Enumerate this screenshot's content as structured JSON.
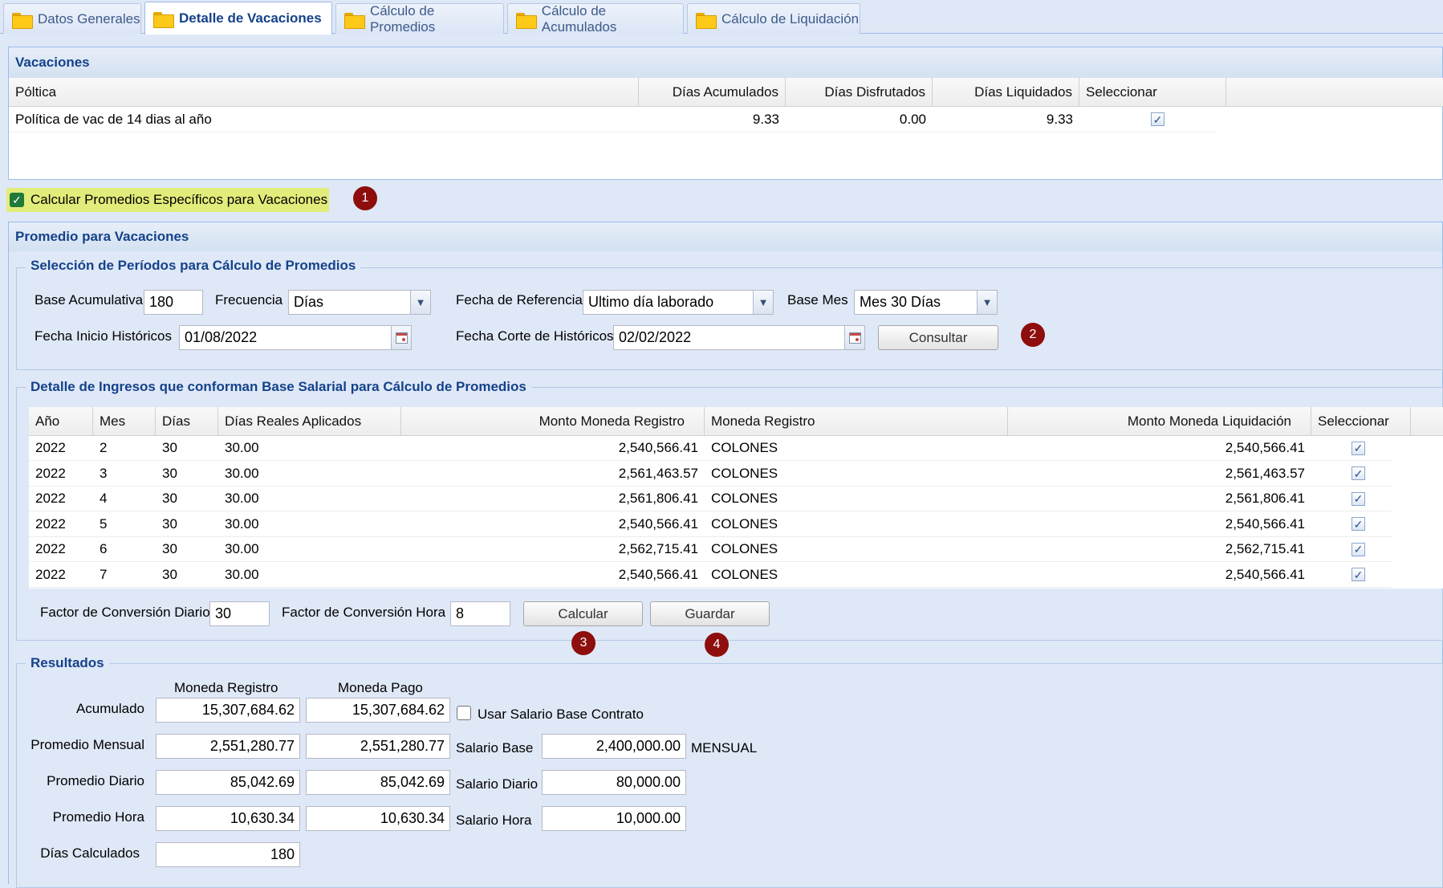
{
  "tabs": [
    {
      "label": "Datos Generales"
    },
    {
      "label": "Detalle de Vacaciones"
    },
    {
      "label": "Cálculo de Promedios"
    },
    {
      "label": "Cálculo de Acumulados"
    },
    {
      "label": "Cálculo de Liquidación"
    }
  ],
  "vacaciones": {
    "title": "Vacaciones",
    "headers": [
      "Póltica",
      "Días Acumulados",
      "Días Disfrutados",
      "Días Liquidados",
      "Seleccionar"
    ],
    "row": {
      "politica": "Política de vac de 14 dias al año",
      "acumulados": "9.33",
      "disfrutados": "0.00",
      "liquidados": "9.33",
      "selected": true
    }
  },
  "calc_checkbox": {
    "label": "Calcular Promedios Específicos para Vacaciones",
    "checked": true
  },
  "markers": [
    "1",
    "2",
    "3",
    "4"
  ],
  "promedio": {
    "title": "Promedio para Vacaciones",
    "seleccion": {
      "legend": "Selección de Períodos para Cálculo de Promedios",
      "base_acumulativa_label": "Base Acumulativa",
      "base_acumulativa": "180",
      "frecuencia_label": "Frecuencia",
      "frecuencia": "Días",
      "fecha_ref_label": "Fecha de Referencia",
      "fecha_ref": "Ultimo día laborado",
      "base_mes_label": "Base Mes",
      "base_mes": "Mes 30 Días",
      "fecha_inicio_label": "Fecha Inicio Históricos",
      "fecha_inicio": "01/08/2022",
      "fecha_corte_label": "Fecha Corte de Históricos",
      "fecha_corte": "02/02/2022",
      "consultar": "Consultar"
    },
    "detalle": {
      "legend": "Detalle de Ingresos que conforman Base Salarial para Cálculo de Promedios",
      "headers": [
        "Año",
        "Mes",
        "Días",
        "Días Reales Aplicados",
        "Monto Moneda Registro",
        "Moneda Registro",
        "Monto Moneda Liquidación",
        "Seleccionar"
      ],
      "rows": [
        {
          "anio": "2022",
          "mes": "2",
          "dias": "30",
          "reales": "30.00",
          "monto": "2,540,566.41",
          "moneda": "COLONES",
          "liq": "2,540,566.41",
          "sel": true
        },
        {
          "anio": "2022",
          "mes": "3",
          "dias": "30",
          "reales": "30.00",
          "monto": "2,561,463.57",
          "moneda": "COLONES",
          "liq": "2,561,463.57",
          "sel": true
        },
        {
          "anio": "2022",
          "mes": "4",
          "dias": "30",
          "reales": "30.00",
          "monto": "2,561,806.41",
          "moneda": "COLONES",
          "liq": "2,561,806.41",
          "sel": true
        },
        {
          "anio": "2022",
          "mes": "5",
          "dias": "30",
          "reales": "30.00",
          "monto": "2,540,566.41",
          "moneda": "COLONES",
          "liq": "2,540,566.41",
          "sel": true
        },
        {
          "anio": "2022",
          "mes": "6",
          "dias": "30",
          "reales": "30.00",
          "monto": "2,562,715.41",
          "moneda": "COLONES",
          "liq": "2,562,715.41",
          "sel": true
        },
        {
          "anio": "2022",
          "mes": "7",
          "dias": "30",
          "reales": "30.00",
          "monto": "2,540,566.41",
          "moneda": "COLONES",
          "liq": "2,540,566.41",
          "sel": true
        }
      ],
      "factor_diario_label": "Factor de Conversión Diario",
      "factor_diario": "30",
      "factor_hora_label": "Factor de Conversión Hora",
      "factor_hora": "8",
      "calcular": "Calcular",
      "guardar": "Guardar"
    },
    "resultados": {
      "legend": "Resultados",
      "col_registro": "Moneda Registro",
      "col_pago": "Moneda Pago",
      "rows": [
        {
          "label": "Acumulado",
          "registro": "15,307,684.62",
          "pago": "15,307,684.62"
        },
        {
          "label": "Promedio Mensual",
          "registro": "2,551,280.77",
          "pago": "2,551,280.77"
        },
        {
          "label": "Promedio Diario",
          "registro": "85,042.69",
          "pago": "85,042.69"
        },
        {
          "label": "Promedio Hora",
          "registro": "10,630.34",
          "pago": "10,630.34"
        },
        {
          "label": "Días Calculados",
          "registro": "180"
        }
      ],
      "usar_salario_label": "Usar Salario Base Contrato",
      "usar_salario_checked": false,
      "salario_base_label": "Salario Base",
      "salario_base": "2,400,000.00",
      "salario_base_unit": "MENSUAL",
      "salario_diario_label": "Salario Diario",
      "salario_diario": "80,000.00",
      "salario_hora_label": "Salario Hora",
      "salario_hora": "10,000.00"
    }
  }
}
